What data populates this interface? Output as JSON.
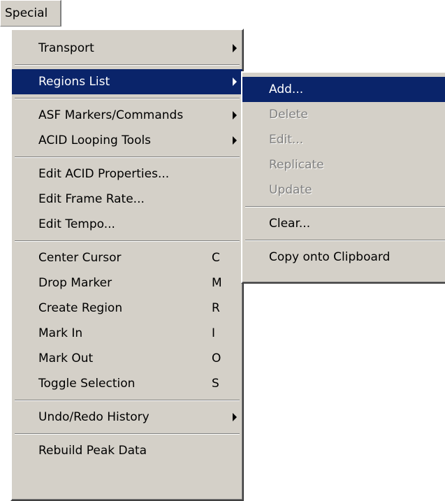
{
  "menubar": {
    "special_label": "Special"
  },
  "main_menu": {
    "items": [
      {
        "label": "Transport"
      },
      {
        "label": "Regions List"
      },
      {
        "label": "ASF Markers/Commands"
      },
      {
        "label": "ACID Looping Tools"
      },
      {
        "label": "Edit ACID Properties..."
      },
      {
        "label": "Edit Frame Rate..."
      },
      {
        "label": "Edit Tempo..."
      },
      {
        "label": "Center Cursor",
        "shortcut": "C"
      },
      {
        "label": "Drop Marker",
        "shortcut": "M"
      },
      {
        "label": "Create Region",
        "shortcut": "R"
      },
      {
        "label": "Mark In",
        "shortcut": "I"
      },
      {
        "label": "Mark Out",
        "shortcut": "O"
      },
      {
        "label": "Toggle Selection",
        "shortcut": "S"
      },
      {
        "label": "Undo/Redo History"
      },
      {
        "label": "Rebuild Peak Data"
      }
    ]
  },
  "sub_menu": {
    "items": [
      {
        "label": "Add..."
      },
      {
        "label": "Delete"
      },
      {
        "label": "Edit..."
      },
      {
        "label": "Replicate"
      },
      {
        "label": "Update"
      },
      {
        "label": "Clear..."
      },
      {
        "label": "Copy onto Clipboard"
      }
    ]
  },
  "colors": {
    "menu_bg": "#d4d0c8",
    "highlight": "#0a246a",
    "disabled_text": "#808080"
  }
}
